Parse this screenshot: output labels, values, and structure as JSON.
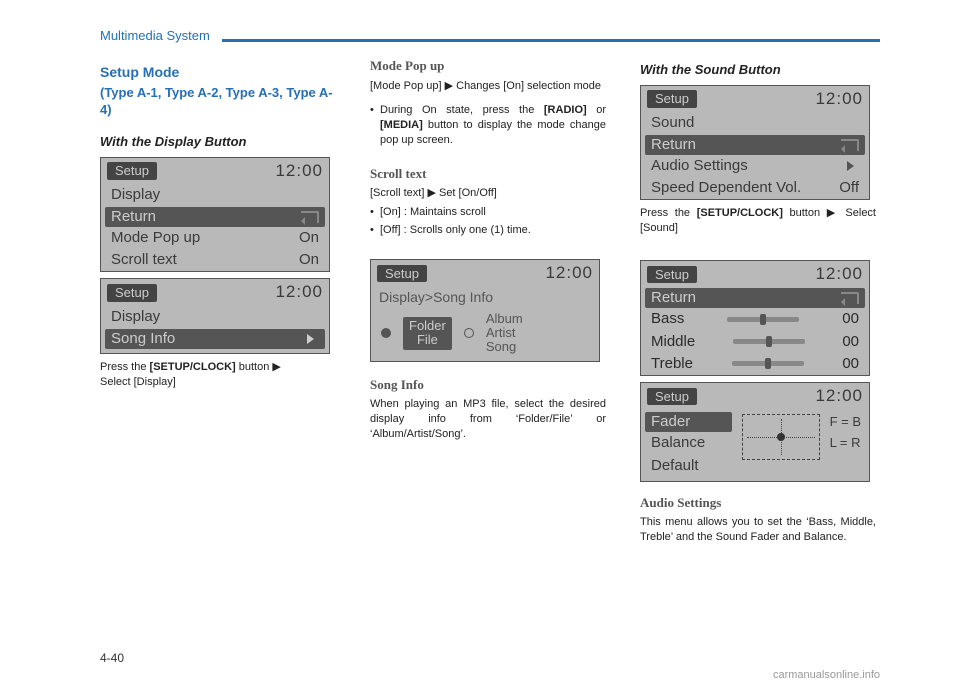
{
  "header": {
    "section": "Multimedia System"
  },
  "page_number": "4-40",
  "watermark": "carmanualsonline.info",
  "col1": {
    "title_line1": "Setup Mode",
    "title_line2": "(Type A-1, Type A-2, Type A-3, Type A-4)",
    "subhead": "With the Display Button",
    "screen1": {
      "setup": "Setup",
      "clock": "12:00",
      "r1": "Display",
      "r2": "Return",
      "r3_label": "Mode Pop up",
      "r3_val": "On",
      "r4_label": "Scroll text",
      "r4_val": "On"
    },
    "screen2": {
      "setup": "Setup",
      "clock": "12:00",
      "r1": "Display",
      "r2": "Song Info"
    },
    "caption_a": "Press the ",
    "caption_b": "[SETUP/CLOCK]",
    "caption_c": " button   Select [Display]",
    "arrow": "▶"
  },
  "col2": {
    "h_mode": "Mode Pop up",
    "mode_line": "[Mode Pop up]  ▶  Changes [On] selection mode",
    "mode_bullet_a": "During On state, press the ",
    "mode_bold1": "[RADIO]",
    "mode_mid": " or ",
    "mode_bold2": "[MEDIA]",
    "mode_bullet_b": " button to display the mode change pop up screen.",
    "h_scroll": "Scroll text",
    "scroll_line": "[Scroll text] ▶ Set [On/Off]",
    "scroll_on": "[On] : Maintains scroll",
    "scroll_off": "[Off] : Scrolls only one (1) time.",
    "screen3": {
      "setup": "Setup",
      "clock": "12:00",
      "crumb": "Display>Song Info",
      "folder1": "Folder",
      "folder2": "File",
      "alt1": "Album",
      "alt2": "Artist",
      "alt3": "Song"
    },
    "h_song": "Song Info",
    "song_para": "When playing an MP3 file, select the desired display info from ‘Folder/File’ or ‘Album/Artist/Song’."
  },
  "col3": {
    "subhead": "With the Sound Button",
    "screen4": {
      "setup": "Setup",
      "clock": "12:00",
      "r1": "Sound",
      "r2": "Return",
      "r3_label": "Audio Settings",
      "r4_label": "Speed Dependent Vol.",
      "r4_val": "Off"
    },
    "caption_a": "Press the ",
    "caption_b": "[SETUP/CLOCK]",
    "caption_c": " button  ▶ Select [Sound]",
    "screen5": {
      "setup": "Setup",
      "clock": "12:00",
      "r1": "Return",
      "bass": "Bass",
      "bass_v": "00",
      "mid": "Middle",
      "mid_v": "00",
      "treb": "Treble",
      "treb_v": "00"
    },
    "screen6": {
      "setup": "Setup",
      "clock": "12:00",
      "fader": "Fader",
      "fb": "F = B",
      "balance": "Balance",
      "lr": "L = R",
      "default": "Default"
    },
    "h_audio": "Audio Settings",
    "audio_para": "This menu allows you to set the ‘Bass, Middle, Treble’ and the Sound Fader and Balance."
  }
}
